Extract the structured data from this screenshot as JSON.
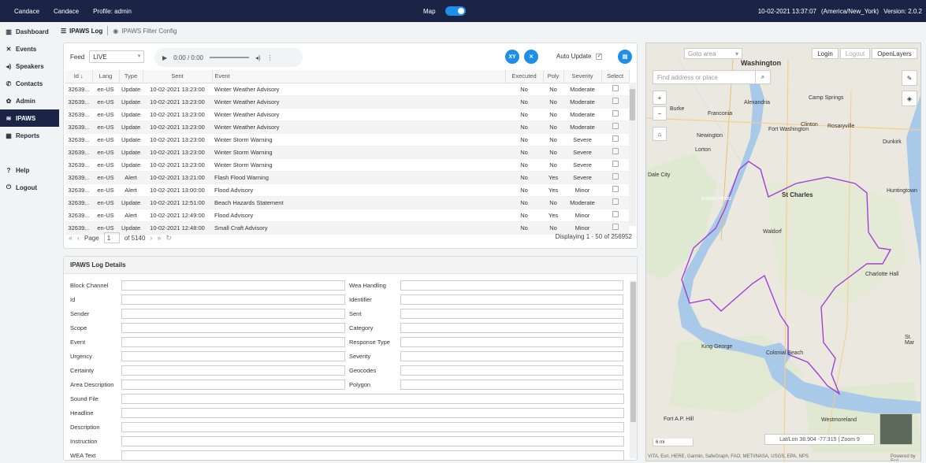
{
  "topbar": {
    "user1": "Candace",
    "user2": "Candace",
    "profile": "Profile: admin",
    "map_label": "Map",
    "datetime": "10-02-2021 13:37:07",
    "timezone": "(America/New_York)",
    "version": "Version: 2.0.2"
  },
  "sidebar": {
    "items": [
      {
        "label": "Dashboard",
        "icon": "bar-chart-icon"
      },
      {
        "label": "Events",
        "icon": "crosshair-icon"
      },
      {
        "label": "Speakers",
        "icon": "speaker-icon"
      },
      {
        "label": "Contacts",
        "icon": "phone-icon"
      },
      {
        "label": "Admin",
        "icon": "gear-icon"
      },
      {
        "label": "IPAWS",
        "icon": "broadcast-icon"
      },
      {
        "label": "Reports",
        "icon": "table-icon"
      },
      {
        "label": "Help",
        "icon": "help-icon"
      },
      {
        "label": "Logout",
        "icon": "power-icon"
      }
    ]
  },
  "tabs": {
    "log": "IPAWS Log",
    "filter": "IPAWS Filter Config"
  },
  "log": {
    "feed_label": "Feed",
    "feed_value": "LIVE",
    "audio_time": "0:00 / 0:00",
    "xy_label": "XY",
    "x_label": "✕",
    "auto_update": "Auto Update",
    "columns": [
      "Id ↓",
      "Lang",
      "Type",
      "Sent",
      "Event",
      "Executed",
      "Poly",
      "Severity",
      "Select"
    ],
    "rows": [
      [
        "32639...",
        "en-US",
        "Update",
        "10-02-2021 13:23:00",
        "Winter Weather Advisory",
        "No",
        "No",
        "Moderate"
      ],
      [
        "32639...",
        "en-US",
        "Update",
        "10-02-2021 13:23:00",
        "Winter Weather Advisory",
        "No",
        "No",
        "Moderate"
      ],
      [
        "32639...",
        "en-US",
        "Update",
        "10-02-2021 13:23:00",
        "Winter Weather Advisory",
        "No",
        "No",
        "Moderate"
      ],
      [
        "32639...",
        "en-US",
        "Update",
        "10-02-2021 13:23:00",
        "Winter Weather Advisory",
        "No",
        "No",
        "Moderate"
      ],
      [
        "32639...",
        "en-US",
        "Update",
        "10-02-2021 13:23:00",
        "Winter Storm Warning",
        "No",
        "No",
        "Severe"
      ],
      [
        "32639...",
        "en-US",
        "Update",
        "10-02-2021 13:23:00",
        "Winter Storm Warning",
        "No",
        "No",
        "Severe"
      ],
      [
        "32639...",
        "en-US",
        "Update",
        "10-02-2021 13:23:00",
        "Winter Storm Warning",
        "No",
        "No",
        "Severe"
      ],
      [
        "32639...",
        "en-US",
        "Alert",
        "10-02-2021 13:21:00",
        "Flash Flood Warning",
        "No",
        "Yes",
        "Severe"
      ],
      [
        "32639...",
        "en-US",
        "Alert",
        "10-02-2021 13:00:00",
        "Flood Advisory",
        "No",
        "Yes",
        "Minor"
      ],
      [
        "32639...",
        "en-US",
        "Update",
        "10-02-2021 12:51:00",
        "Beach Hazards Statement",
        "No",
        "No",
        "Moderate"
      ],
      [
        "32639...",
        "en-US",
        "Alert",
        "10-02-2021 12:49:00",
        "Flood Advisory",
        "No",
        "Yes",
        "Minor"
      ],
      [
        "32639...",
        "en-US",
        "Update",
        "10-02-2021 12:48:00",
        "Small Craft Advisory",
        "No",
        "No",
        "Minor"
      ]
    ],
    "pager": {
      "page_label": "Page",
      "page": "1",
      "of_pages": "of 5140",
      "displaying": "Displaying 1 - 50 of 256952"
    }
  },
  "details": {
    "title": "IPAWS Log Details",
    "left_fields": [
      "Block Channel",
      "Id",
      "Sender",
      "Scope",
      "Event",
      "Urgency",
      "Certainty",
      "Area Description"
    ],
    "right_fields": [
      "Wea Handling",
      "Identifier",
      "Sent",
      "Category",
      "Response Type",
      "Severity",
      "Geocodes",
      "Polygon"
    ],
    "full_fields": [
      "Sound File",
      "Headline",
      "Description",
      "Instruction",
      "WEA Text"
    ]
  },
  "map": {
    "goto": "Goto area",
    "login": "Login",
    "logout": "Logout",
    "layers": "OpenLayers",
    "search_placeholder": "Find address or place",
    "scale": "6 mi",
    "latlon": "Lat/Lon 38.904 -77.315 | Zoom 9",
    "attribution": "VITA, Esri, HERE, Garmin, SafeGraph, FAO, METI/NASA, USGS, EPA, NPS",
    "powered": "Powered by Esri",
    "places": [
      "Washington",
      "Alexandria",
      "Franconia",
      "Burke",
      "Fort Washington",
      "Clinton",
      "Rosaryville",
      "Camp Springs",
      "Newington",
      "Lorton",
      "Dunkirk",
      "St Charles",
      "Huntingtown",
      "Charlotte Hall",
      "Indian Head",
      "Dale City",
      "King George",
      "Colonial Beach",
      "Westmoreland",
      "Fort A.P. Hill",
      "Waldorf",
      "St. Mar"
    ]
  }
}
